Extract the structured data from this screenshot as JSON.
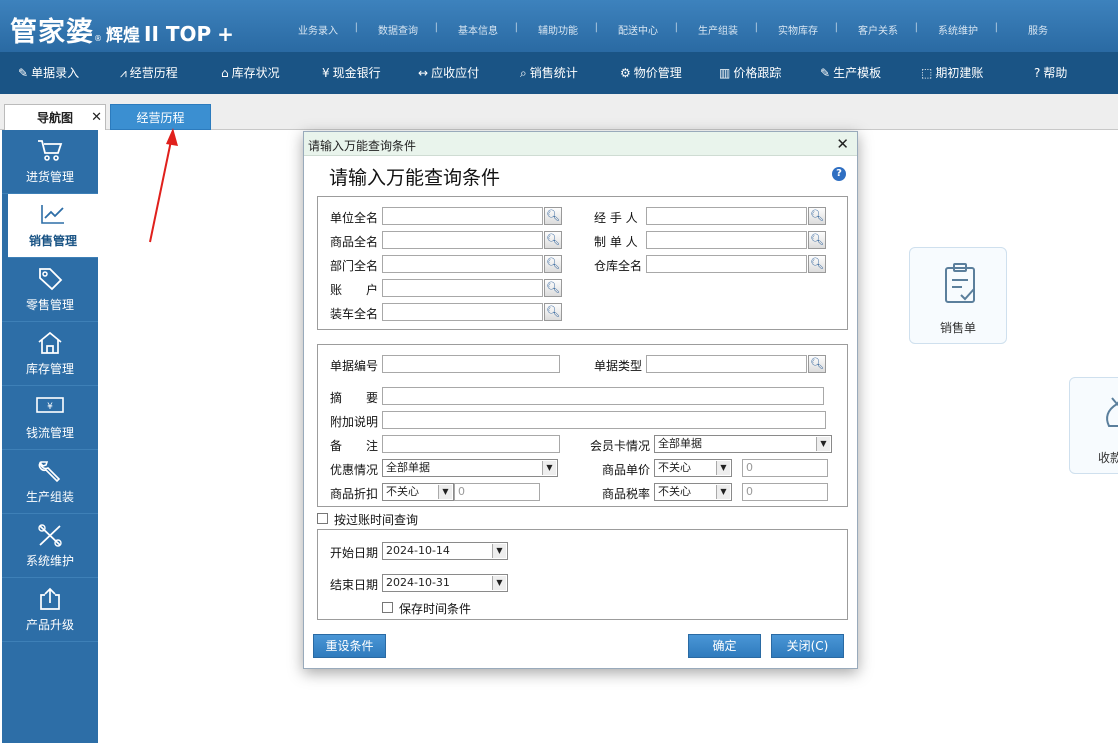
{
  "app": {
    "logo_main": "管家婆",
    "logo_sub": "辉煌",
    "logo_version": "II TOP",
    "logo_plus": "+",
    "logo_reg": "®"
  },
  "top_nav": [
    "业务录入",
    "数据查询",
    "基本信息",
    "辅助功能",
    "配送中心",
    "生产组装",
    "实物库存",
    "客户关系",
    "系统维护",
    "服务"
  ],
  "toolbar": [
    {
      "icon": "document-edit-icon",
      "glyph": "✎",
      "label": "单据录入"
    },
    {
      "icon": "line-chart-icon",
      "glyph": "⩘",
      "label": "经营历程"
    },
    {
      "icon": "home-icon",
      "glyph": "⌂",
      "label": "库存状况"
    },
    {
      "icon": "yen-icon",
      "glyph": "¥",
      "label": "现金银行"
    },
    {
      "icon": "exchange-icon",
      "glyph": "↔",
      "label": "应收应付"
    },
    {
      "icon": "search-icon",
      "glyph": "⌕",
      "label": "销售统计"
    },
    {
      "icon": "gear-icon",
      "glyph": "⚙",
      "label": "物价管理"
    },
    {
      "icon": "bar-chart-icon",
      "glyph": "▥",
      "label": "价格跟踪"
    },
    {
      "icon": "wrench-icon",
      "glyph": "✎",
      "label": "生产模板"
    },
    {
      "icon": "external-link-icon",
      "glyph": "⬚",
      "label": "期初建账"
    },
    {
      "icon": "help-icon",
      "glyph": "?",
      "label": "帮助"
    }
  ],
  "tabs": {
    "nav": "导航图",
    "close": "✕",
    "active": "经营历程"
  },
  "sidebar": [
    {
      "icon": "cart-icon",
      "label": "进货管理"
    },
    {
      "icon": "trend-chart-icon",
      "label": "销售管理"
    },
    {
      "icon": "tag-icon",
      "label": "零售管理"
    },
    {
      "icon": "warehouse-icon",
      "label": "库存管理"
    },
    {
      "icon": "money-icon",
      "label": "钱流管理"
    },
    {
      "icon": "wrench-icon",
      "label": "生产组装"
    },
    {
      "icon": "tools-icon",
      "label": "系统维护"
    },
    {
      "icon": "upload-icon",
      "label": "产品升级"
    }
  ],
  "content": {
    "card1": "销售单",
    "card2": "收款"
  },
  "dialog": {
    "window_title": "请输入万能查询条件",
    "heading": "请输入万能查询条件",
    "help": "?",
    "close": "✕",
    "group1": {
      "unit": "单位全名",
      "product": "商品全名",
      "dept": "部门全名",
      "account": "账　　户",
      "loading": "装车全名",
      "handler": "经 手 人",
      "maker": "制 单 人",
      "warehouse": "仓库全名"
    },
    "group2": {
      "doc_no": "单据编号",
      "doc_type": "单据类型",
      "summary": "摘　　要",
      "extra": "附加说明",
      "remark": "备　　注",
      "member_card": "会员卡情况",
      "member_card_value": "全部单据",
      "discount": "优惠情况",
      "discount_value": "全部单据",
      "price": "商品单价",
      "price_cond": "不关心",
      "price_value": "0",
      "rebate": "商品折扣",
      "rebate_cond": "不关心",
      "rebate_value": "0",
      "tax": "商品税率",
      "tax_cond": "不关心",
      "tax_value": "0"
    },
    "post_time_check": "按过账时间查询",
    "group3": {
      "start_label": "开始日期",
      "start_value": "2024-10-14",
      "end_label": "结束日期",
      "end_value": "2024-10-31",
      "save_check": "保存时间条件"
    },
    "buttons": {
      "reset": "重设条件",
      "ok": "确定",
      "close": "关闭(C)"
    }
  }
}
